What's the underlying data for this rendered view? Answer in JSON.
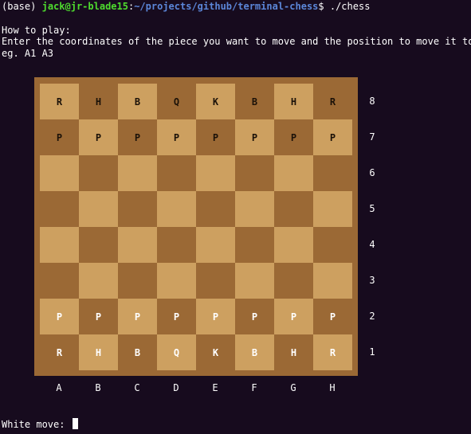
{
  "prompt": {
    "env": "(base)",
    "user_host": "jack@jr-blade15",
    "separator": ":",
    "path": "~/projects/github/terminal-chess",
    "dollar": "$",
    "command": "./chess"
  },
  "instructions": {
    "heading": "How to play:",
    "line1": "Enter the coordinates of the piece you want to move and the position to move it to.",
    "line2": "eg. A1 A3"
  },
  "board": {
    "files": [
      "A",
      "B",
      "C",
      "D",
      "E",
      "F",
      "G",
      "H"
    ],
    "ranks": [
      "8",
      "7",
      "6",
      "5",
      "4",
      "3",
      "2",
      "1"
    ],
    "rows": [
      [
        "R",
        "H",
        "B",
        "Q",
        "K",
        "B",
        "H",
        "R"
      ],
      [
        "P",
        "P",
        "P",
        "P",
        "P",
        "P",
        "P",
        "P"
      ],
      [
        "",
        "",
        "",
        "",
        "",
        "",
        "",
        ""
      ],
      [
        "",
        "",
        "",
        "",
        "",
        "",
        "",
        ""
      ],
      [
        "",
        "",
        "",
        "",
        "",
        "",
        "",
        ""
      ],
      [
        "",
        "",
        "",
        "",
        "",
        "",
        "",
        ""
      ],
      [
        "P",
        "P",
        "P",
        "P",
        "P",
        "P",
        "P",
        "P"
      ],
      [
        "R",
        "H",
        "B",
        "Q",
        "K",
        "B",
        "H",
        "R"
      ]
    ],
    "light_color": "#cda060",
    "dark_color": "#9b6935",
    "black_piece_color": "#1b1108",
    "white_piece_color": "#ffffff"
  },
  "input": {
    "label": "White move:",
    "value": ""
  },
  "colors": {
    "background": "#170b1e",
    "user_host": "#4edb2e",
    "path": "#5b86d8"
  }
}
